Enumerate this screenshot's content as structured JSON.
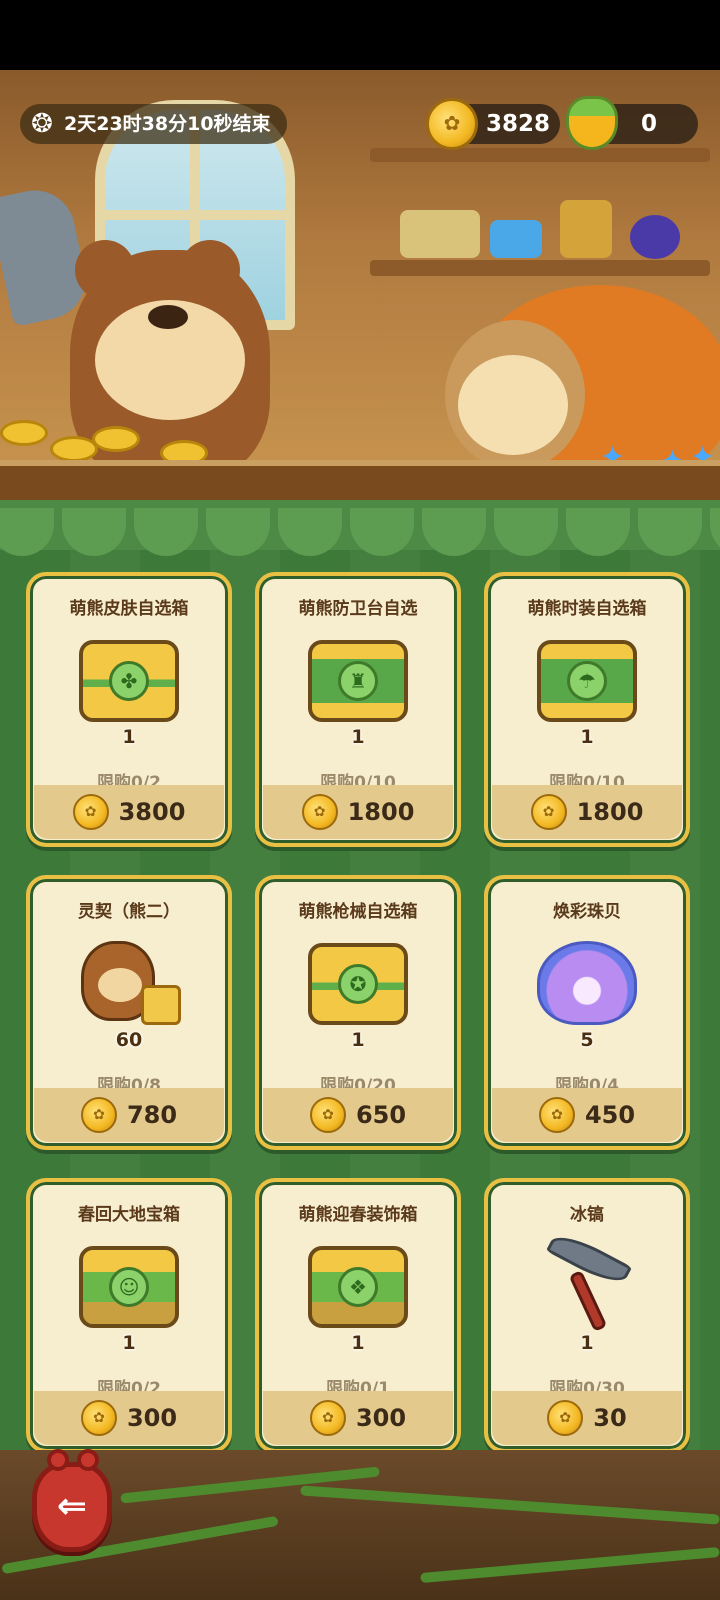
{
  "header": {
    "timer_text": "2天23时38分10秒结束",
    "timer_icon": "paw-icon",
    "coins": "3828",
    "honey": "0"
  },
  "items": [
    {
      "title": "萌熊皮肤自选箱",
      "qty": "1",
      "limit": "限购0/2",
      "price": "3800",
      "icon": "skin-chest-icon"
    },
    {
      "title": "萌熊防卫台自选",
      "qty": "1",
      "limit": "限购0/10",
      "price": "1800",
      "icon": "turret-chest-icon"
    },
    {
      "title": "萌熊时装自选箱",
      "qty": "1",
      "limit": "限购0/10",
      "price": "1800",
      "icon": "outfit-chest-icon"
    },
    {
      "title": "灵契（熊二）",
      "qty": "60",
      "limit": "限购0/8",
      "price": "780",
      "icon": "bear-contract-icon"
    },
    {
      "title": "萌熊枪械自选箱",
      "qty": "1",
      "limit": "限购0/20",
      "price": "650",
      "icon": "weapon-chest-icon"
    },
    {
      "title": "焕彩珠贝",
      "qty": "5",
      "limit": "限购0/4",
      "price": "450",
      "icon": "pearl-shell-icon"
    },
    {
      "title": "春回大地宝箱",
      "qty": "1",
      "limit": "限购0/2",
      "price": "300",
      "icon": "spring-chest-icon"
    },
    {
      "title": "萌熊迎春装饰箱",
      "qty": "1",
      "limit": "限购0/1",
      "price": "300",
      "icon": "spring-deco-chest-icon"
    },
    {
      "title": "冰镐",
      "qty": "1",
      "limit": "限购0/30",
      "price": "30",
      "icon": "pickaxe-icon"
    }
  ],
  "colors": {
    "card_border": "#e9c042",
    "card_bg": "#f7edcf",
    "shop_bg": "#3e7a3a",
    "back_button": "#c8372e"
  }
}
